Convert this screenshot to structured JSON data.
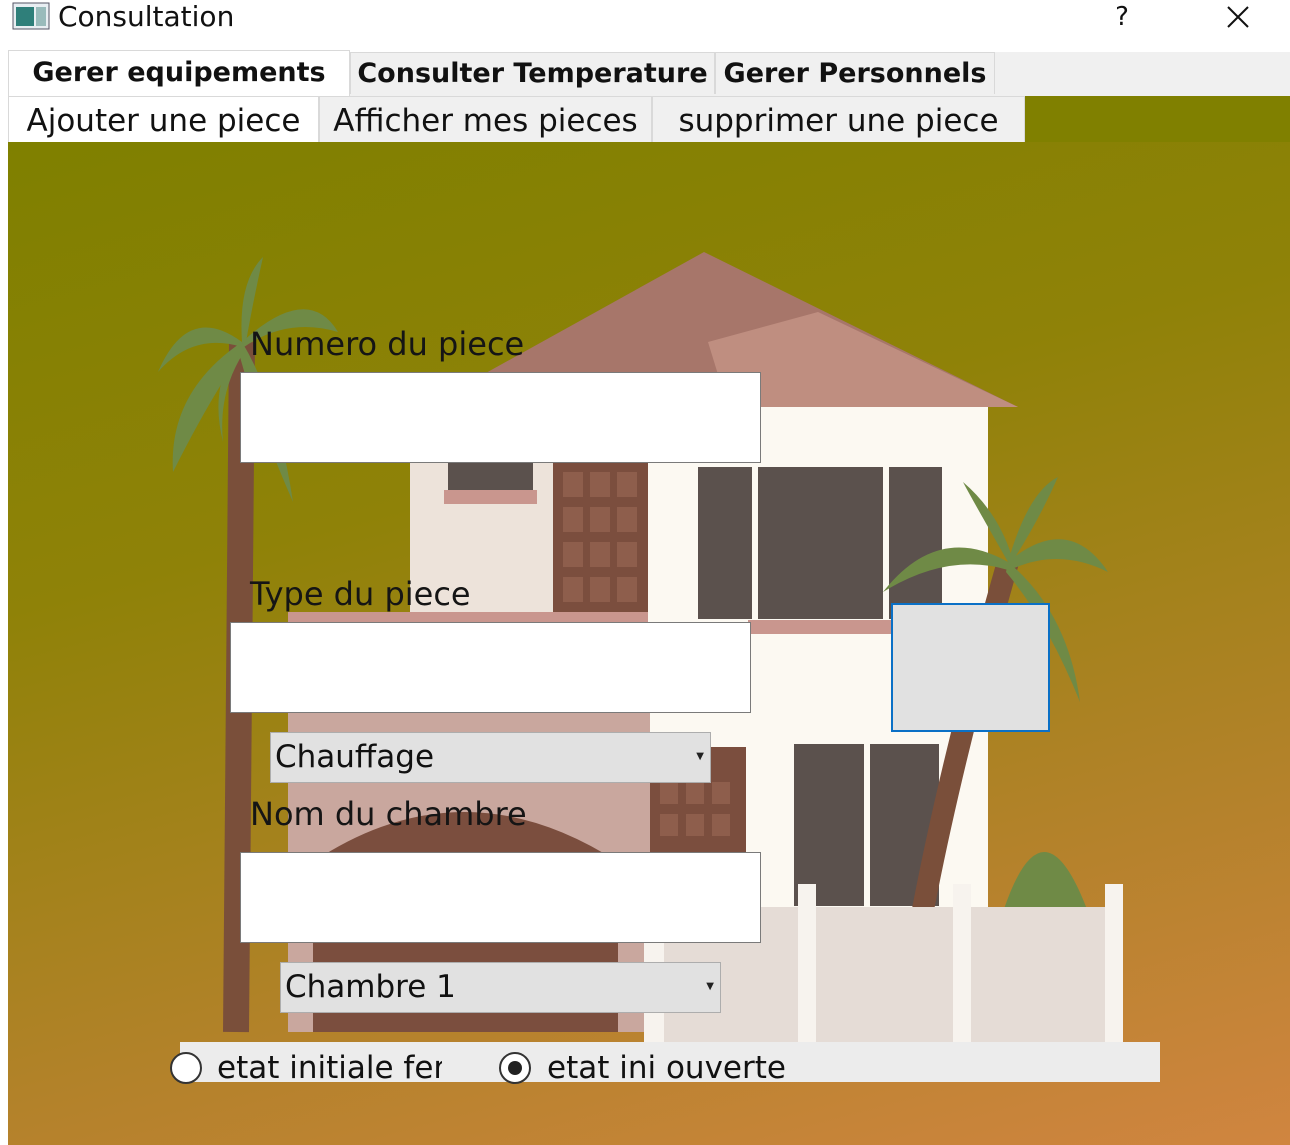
{
  "window": {
    "title": "Consultation",
    "help_label": "?",
    "close_label": "✕"
  },
  "outer_tabs": [
    {
      "label": "Gerer equipements",
      "active": true
    },
    {
      "label": "Consulter Temperature",
      "active": false
    },
    {
      "label": "Gerer Personnels",
      "active": false
    }
  ],
  "inner_tabs": [
    {
      "label": "Ajouter une piece",
      "active": true
    },
    {
      "label": "Afficher mes pieces",
      "active": false
    },
    {
      "label": "supprimer une piece",
      "active": false
    }
  ],
  "form": {
    "numero_label": "Numero du piece",
    "numero_value": "",
    "type_label": "Type du piece",
    "type_value": "",
    "type_combo_selected": "Chauffage",
    "nom_label": "Nom du chambre",
    "nom_value": "",
    "chambre_combo_selected": "Chambre 1"
  },
  "radios": {
    "closed_label": "etat initiale ferm",
    "closed_checked": false,
    "open_label": "etat ini ouverte",
    "open_checked": true
  },
  "colors": {
    "panel_top": "#7f8000",
    "panel_bottom": "#d08540",
    "accent_border": "#0a70c6"
  },
  "icons": {
    "app": "app-window-icon",
    "combo_arrow": "chevron-down-icon"
  }
}
